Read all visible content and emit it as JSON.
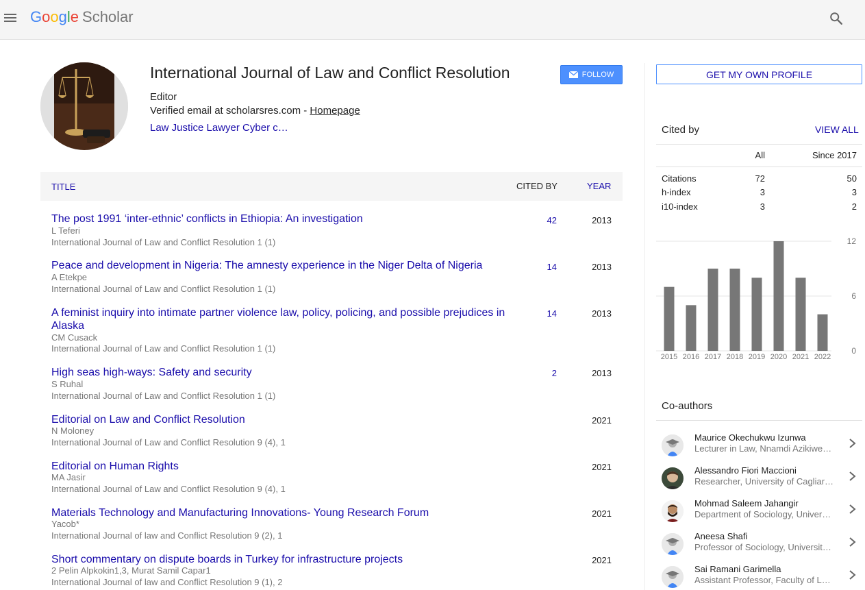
{
  "app": {
    "logo_letters": [
      "G",
      "o",
      "o",
      "g",
      "l",
      "e"
    ],
    "logo_suffix": "Scholar",
    "colors": {
      "link": "#1a0dab",
      "follow": "#4d90fe",
      "bar": "#777777",
      "topbar": "#f5f5f5"
    }
  },
  "profile": {
    "name": "International Journal of Law and Conflict Resolution",
    "affiliation": "Editor",
    "verified_prefix": "Verified email at scholarsres.com - ",
    "homepage_label": "Homepage",
    "interests": "Law Justice Lawyer Cyber c…",
    "follow_label": "FOLLOW"
  },
  "table": {
    "header": {
      "title": "TITLE",
      "cited_by": "CITED BY",
      "year": "YEAR"
    },
    "rows": [
      {
        "title": "The post 1991 ‘inter-ethnic’ conflicts in Ethiopia: An investigation",
        "authors": "L Teferi",
        "venue": "International Journal of Law and Conflict Resolution 1 (1)",
        "cites": "42",
        "year": "2013"
      },
      {
        "title": "Peace and development in Nigeria: The amnesty experience in the Niger Delta of Nigeria",
        "authors": "A Etekpe",
        "venue": "International Journal of Law and Conflict Resolution 1 (1)",
        "cites": "14",
        "year": "2013"
      },
      {
        "title": "A feminist inquiry into intimate partner violence law, policy, policing, and possible prejudices in Alaska",
        "authors": "CM Cusack",
        "venue": "International Journal of Law and Conflict Resolution 1 (1)",
        "cites": "14",
        "year": "2013"
      },
      {
        "title": "High seas high-ways: Safety and security",
        "authors": "S Ruhal",
        "venue": "International Journal of Law and Conflict Resolution 1 (1)",
        "cites": "2",
        "year": "2013"
      },
      {
        "title": "Editorial on Law and Conflict Resolution",
        "authors": "N Moloney",
        "venue": "International Journal of Law and Conflict Resolution 9 (4), 1",
        "cites": "",
        "year": "2021"
      },
      {
        "title": "Editorial on Human Rights",
        "authors": "MA Jasir",
        "venue": "International Journal of Law and Conflict Resolution 9 (4), 1",
        "cites": "",
        "year": "2021"
      },
      {
        "title": "Materials Technology and Manufacturing Innovations- Young Research Forum",
        "authors": "Yacob*",
        "venue": "International Journal of law and Conflict Resolution 9 (2), 1",
        "cites": "",
        "year": "2021"
      },
      {
        "title": "Short commentary on dispute boards in Turkey for infrastructure projects",
        "authors": "2 Pelin Alpkokin1,3, Murat Samil Capar1",
        "venue": "International Journal of law and Conflict Resolution 9 (1), 2",
        "cites": "",
        "year": "2021"
      }
    ]
  },
  "sidebar": {
    "own_profile_label": "GET MY OWN PROFILE",
    "cited_by_label": "Cited by",
    "view_all_label": "VIEW ALL",
    "col_all": "All",
    "col_since": "Since 2017",
    "stats": [
      {
        "label": "Citations",
        "all": "72",
        "since": "50"
      },
      {
        "label": "h-index",
        "all": "3",
        "since": "3"
      },
      {
        "label": "i10-index",
        "all": "3",
        "since": "2"
      }
    ],
    "coauthors_label": "Co-authors",
    "coauthors": [
      {
        "name": "Maurice Okechukwu Izunwa",
        "affil": "Lecturer in Law, Nnamdi Azikiwe…",
        "avatar": "default-avatar"
      },
      {
        "name": "Alessandro Fiori Maccioni",
        "affil": "Researcher, University of Cagliari…",
        "avatar": "photo-avatar"
      },
      {
        "name": "Mohmad Saleem Jahangir",
        "affil": "Department of Sociology, Univers…",
        "avatar": "photo-avatar"
      },
      {
        "name": "Aneesa Shafi",
        "affil": "Professor of Sociology, Universit…",
        "avatar": "default-avatar"
      },
      {
        "name": "Sai Ramani Garimella",
        "affil": "Assistant Professor, Faculty of L…",
        "avatar": "default-avatar"
      }
    ]
  },
  "chart_data": {
    "type": "bar",
    "categories": [
      "2015",
      "2016",
      "2017",
      "2018",
      "2019",
      "2020",
      "2021",
      "2022"
    ],
    "values": [
      7,
      5,
      9,
      9,
      8,
      12,
      8,
      4
    ],
    "ylim": [
      0,
      12
    ],
    "yticks": [
      "0",
      "6",
      "12"
    ],
    "grid": true
  }
}
